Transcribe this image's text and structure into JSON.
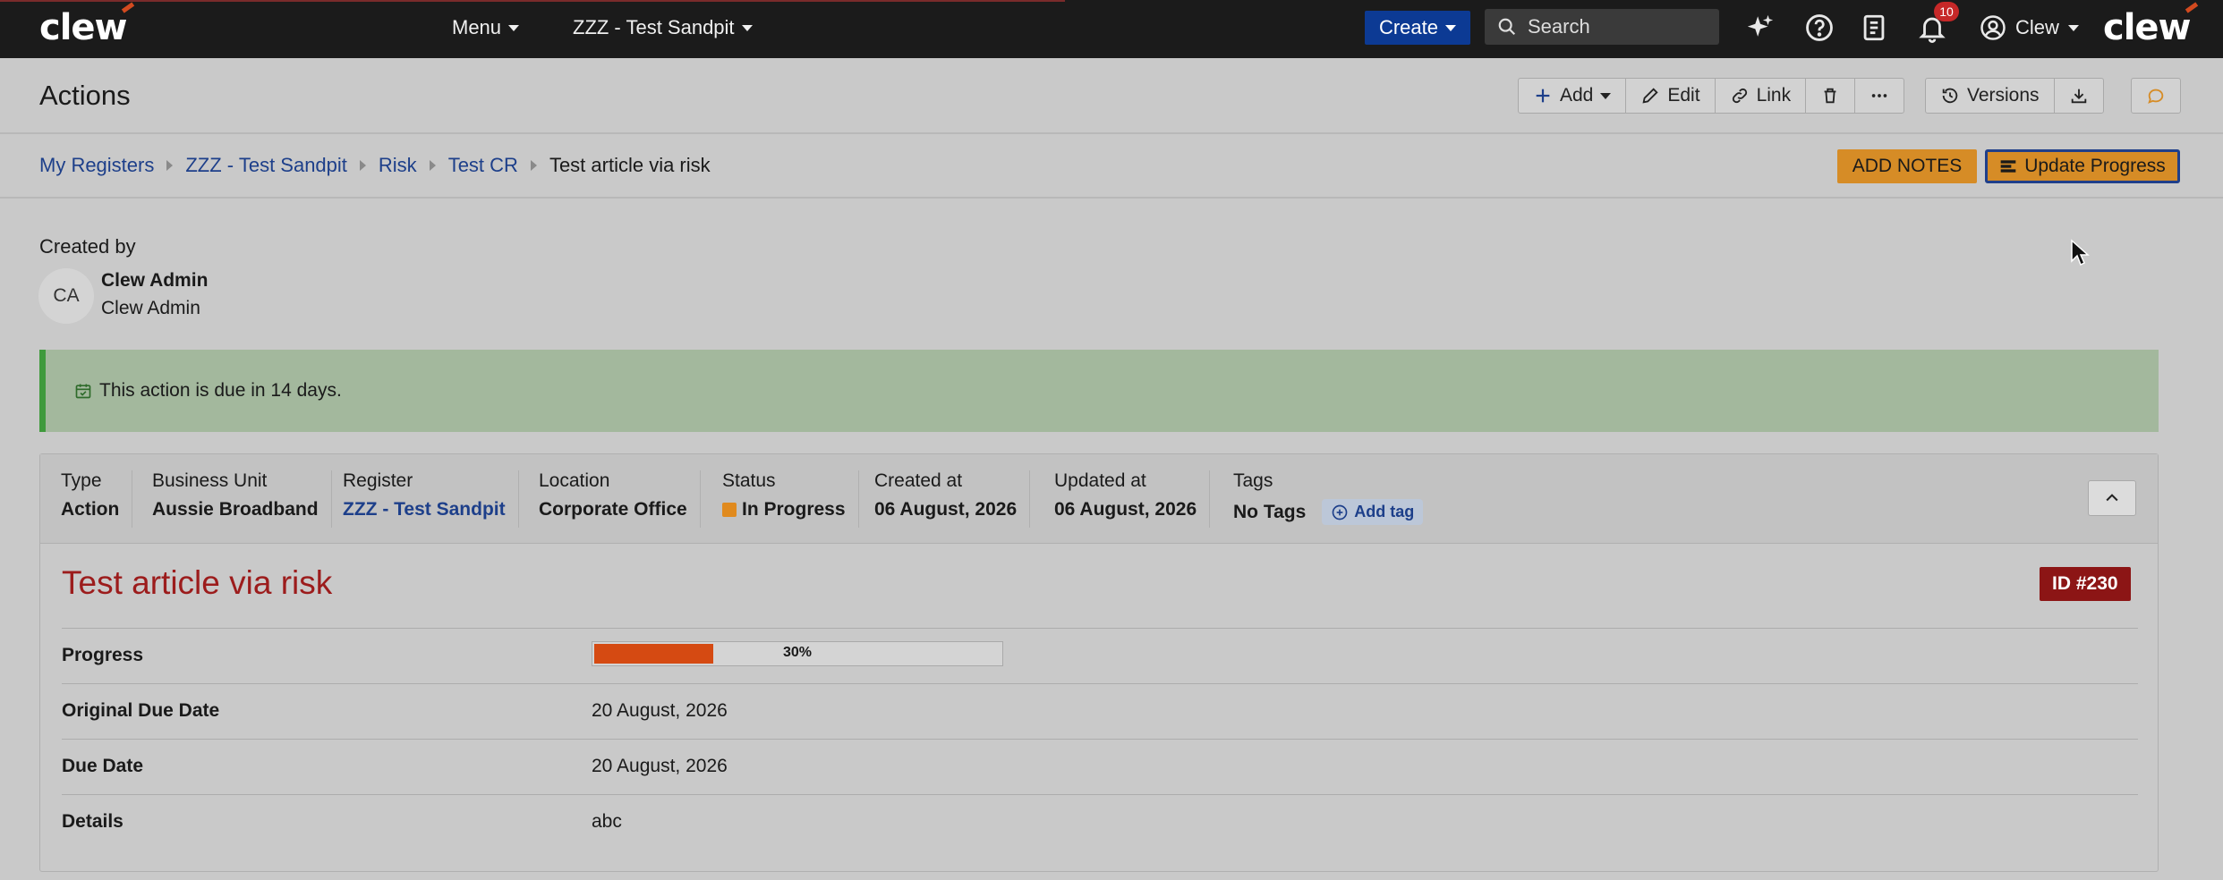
{
  "nav": {
    "logo_left": "clew",
    "logo_right": "clew",
    "menu_label": "Menu",
    "workspace_label": "ZZZ - Test Sandpit",
    "create_label": "Create",
    "search_placeholder": "Search",
    "notification_count": "10",
    "user_label": "Clew"
  },
  "toolbar": {
    "page_title": "Actions",
    "add_label": "Add",
    "edit_label": "Edit",
    "link_label": "Link",
    "versions_label": "Versions"
  },
  "breadcrumb": {
    "items": [
      "My Registers",
      "ZZZ - Test Sandpit",
      "Risk",
      "Test CR"
    ],
    "current": "Test article via risk"
  },
  "actions": {
    "add_notes_label": "ADD NOTES",
    "update_progress_label": "Update Progress"
  },
  "created_by": {
    "label": "Created by",
    "initials": "CA",
    "name": "Clew Admin",
    "subtitle": "Clew Admin"
  },
  "alert": {
    "text": "This action is due in 14 days.",
    "color": "#a3b89d"
  },
  "meta": {
    "type": {
      "label": "Type",
      "value": "Action"
    },
    "business_unit": {
      "label": "Business Unit",
      "value": "Aussie Broadband"
    },
    "register": {
      "label": "Register",
      "value": "ZZZ - Test Sandpit"
    },
    "location": {
      "label": "Location",
      "value": "Corporate Office"
    },
    "status": {
      "label": "Status",
      "value": "In Progress",
      "color": "#e08a1e"
    },
    "created_at": {
      "label": "Created at",
      "value": "06 August, 2026"
    },
    "updated_at": {
      "label": "Updated at",
      "value": "06 August, 2026"
    },
    "tags": {
      "label": "Tags",
      "value": "No Tags",
      "add_tag_label": "Add tag"
    }
  },
  "record": {
    "title": "Test article via risk",
    "id_label": "ID #230",
    "progress_label": "Progress",
    "progress_percent": 30,
    "progress_text": "30%",
    "original_due_date_label": "Original Due Date",
    "original_due_date": "20 August, 2026",
    "due_date_label": "Due Date",
    "due_date": "20 August, 2026",
    "details_label": "Details",
    "details": "abc"
  },
  "colors": {
    "nav_bg": "#1b1b1b",
    "create_btn": "#0c3a94",
    "accent_orange": "#d68c26",
    "title_red": "#9c1c1c",
    "id_badge": "#8c1515",
    "progress_fill": "#d54a12"
  }
}
